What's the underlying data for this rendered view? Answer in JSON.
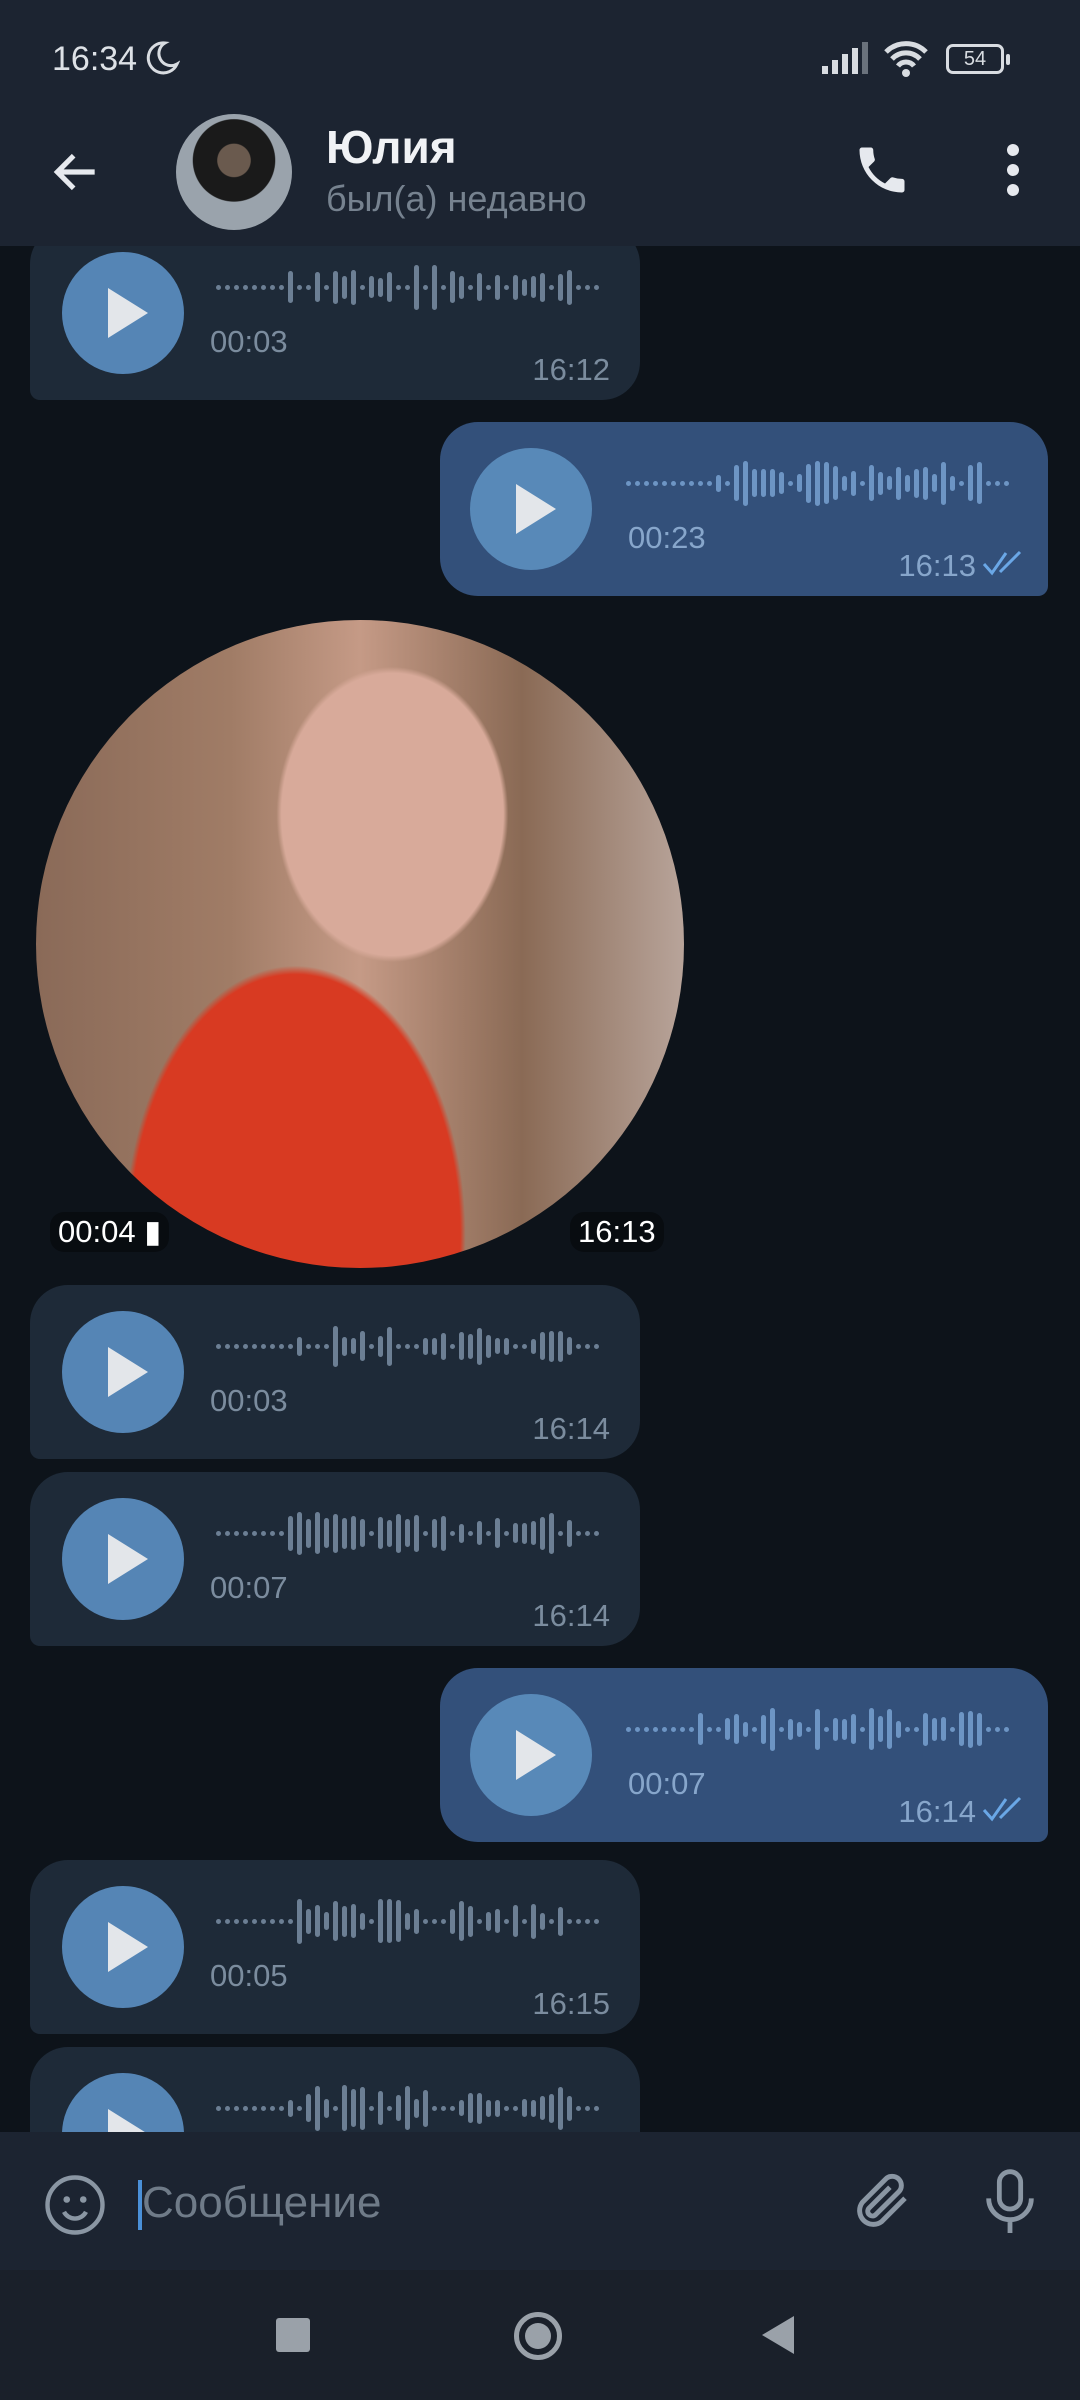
{
  "status_bar": {
    "time": "16:34",
    "battery": "54",
    "icons": [
      "moon-icon",
      "signal-icon",
      "wifi-icon",
      "battery-icon"
    ]
  },
  "header": {
    "name": "Юлия",
    "status": "был(а) недавно"
  },
  "messages": [
    {
      "type": "voice",
      "direction": "in",
      "duration": "00:03",
      "time": "16:12"
    },
    {
      "type": "voice",
      "direction": "out",
      "duration": "00:23",
      "time": "16:13",
      "read": true
    },
    {
      "type": "video_note",
      "direction": "in",
      "duration": "00:04",
      "time": "16:13"
    },
    {
      "type": "voice",
      "direction": "in",
      "duration": "00:03",
      "time": "16:14"
    },
    {
      "type": "voice",
      "direction": "in",
      "duration": "00:07",
      "time": "16:14"
    },
    {
      "type": "voice",
      "direction": "out",
      "duration": "00:07",
      "time": "16:14",
      "read": true
    },
    {
      "type": "voice",
      "direction": "in",
      "duration": "00:05",
      "time": "16:15"
    },
    {
      "type": "voice",
      "direction": "in",
      "duration": "",
      "time": ""
    }
  ],
  "composer": {
    "placeholder": "Сообщение"
  },
  "colors": {
    "header": "#1c2431",
    "incoming": "#1e2a38",
    "outgoing": "#33507a",
    "accent": "#5585b5"
  }
}
